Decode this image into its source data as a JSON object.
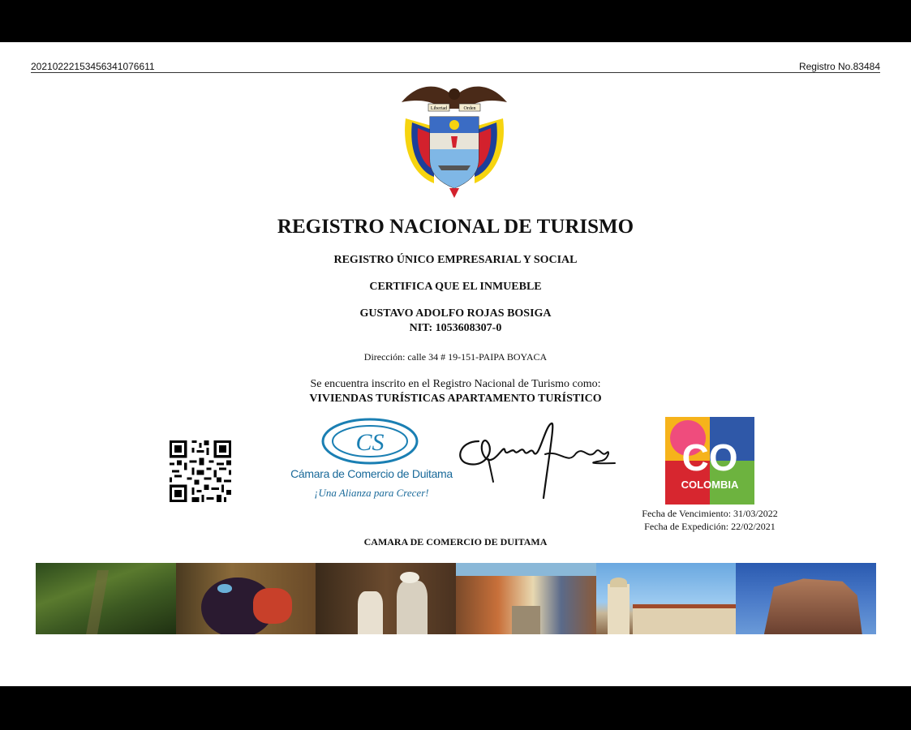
{
  "header": {
    "doc_id": "20210222153456341076611",
    "registro": "Registro No.83484"
  },
  "title": "REGISTRO NACIONAL DE TURISMO",
  "subtitle": "REGISTRO ÚNICO EMPRESARIAL Y SOCIAL",
  "certifica": "CERTIFICA QUE EL INMUEBLE",
  "owner_name": "GUSTAVO ADOLFO ROJAS BOSIGA",
  "nit": "NIT: 1053608307-0",
  "direccion": "Dirección: calle 34 # 19-151-PAIPA BOYACA",
  "inscrito_text": "Se encuentra inscrito en el Registro Nacional de Turismo como:",
  "categoria": "VIVIENDAS TURÍSTICAS APARTAMENTO TURÍSTICO",
  "camara_logo": {
    "name": "Cámara de Comercio de Duitama",
    "slogan": "¡Una Alianza para Crecer!",
    "initials": "CS"
  },
  "colombia_logo": {
    "big": "CO",
    "small": "COLOMBIA"
  },
  "fecha_vencimiento": "Fecha de Vencimiento: 31/03/2022",
  "fecha_expedicion": "Fecha de Expedición: 22/02/2021",
  "issuer": "CAMARA DE COMERCIO DE DUITAMA",
  "crest_motto": [
    "Libertad",
    "Orden"
  ],
  "photo_strip": [
    "forest-path",
    "condor",
    "musicians",
    "colonial-street",
    "church-plaza",
    "rock-monolith"
  ]
}
